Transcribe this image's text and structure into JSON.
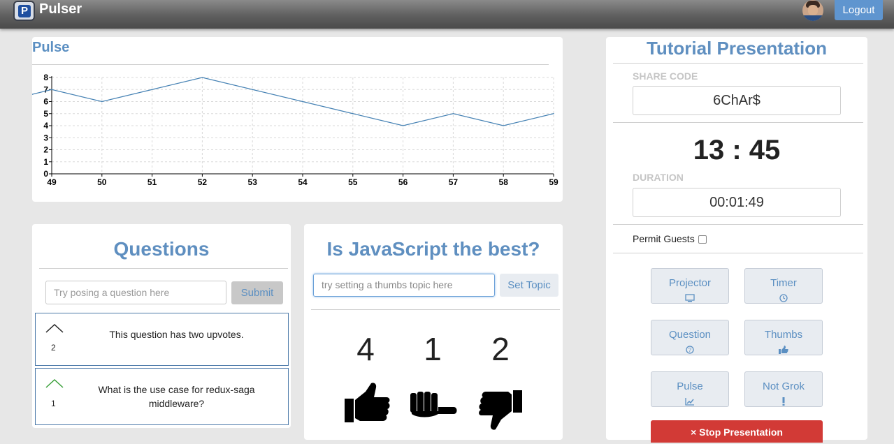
{
  "app": {
    "name": "Pulser",
    "logo_letter": "P"
  },
  "header": {
    "logout_label": "Logout"
  },
  "pulse": {
    "title": "Pulse"
  },
  "chart_data": {
    "type": "line",
    "x": [
      48.6,
      49,
      50,
      51,
      52,
      53,
      54,
      55,
      56,
      57,
      58,
      59
    ],
    "y": [
      6.6,
      7,
      6,
      7,
      8,
      7,
      6,
      5,
      4,
      5,
      4,
      5
    ],
    "xticks": [
      "49",
      "50",
      "51",
      "52",
      "53",
      "54",
      "55",
      "56",
      "57",
      "58",
      "59"
    ],
    "yticks": [
      "0",
      "1",
      "2",
      "3",
      "4",
      "5",
      "6",
      "7",
      "8"
    ],
    "xlim": [
      49,
      59
    ],
    "ylim": [
      0,
      8
    ],
    "grid": true,
    "color": "#4682b4"
  },
  "questions": {
    "title": "Questions",
    "input_placeholder": "Try posing a question here",
    "submit_label": "Submit",
    "items": [
      {
        "text": "This question has two upvotes.",
        "votes": "2",
        "chevron_color": "#222222"
      },
      {
        "text": "What is the use case for redux-saga middleware?",
        "votes": "1",
        "chevron_color": "#3aa03a"
      }
    ]
  },
  "thumbs": {
    "title": "Is JavaScript the best?",
    "input_placeholder": "try setting a thumbs topic here",
    "set_label": "Set Topic",
    "counts": [
      "4",
      "1",
      "2"
    ],
    "icons": [
      "thumbs-up-icon",
      "thumbs-sideways-icon",
      "thumbs-down-icon"
    ]
  },
  "presentation": {
    "title": "Tutorial Presentation",
    "share_code_label": "SHARE CODE",
    "share_code": "6ChAr$",
    "clock": "13 : 45",
    "duration_label": "DURATION",
    "duration": "00:01:49",
    "permit_guests_label": "Permit Guests",
    "tools": {
      "projector": "Projector",
      "timer": "Timer",
      "question": "Question",
      "thumbs": "Thumbs",
      "pulse": "Pulse",
      "not_grok": "Not Grok"
    },
    "stop_label": "Stop Presentation",
    "stop_icon": "×",
    "stop_color": "#d23a36"
  }
}
